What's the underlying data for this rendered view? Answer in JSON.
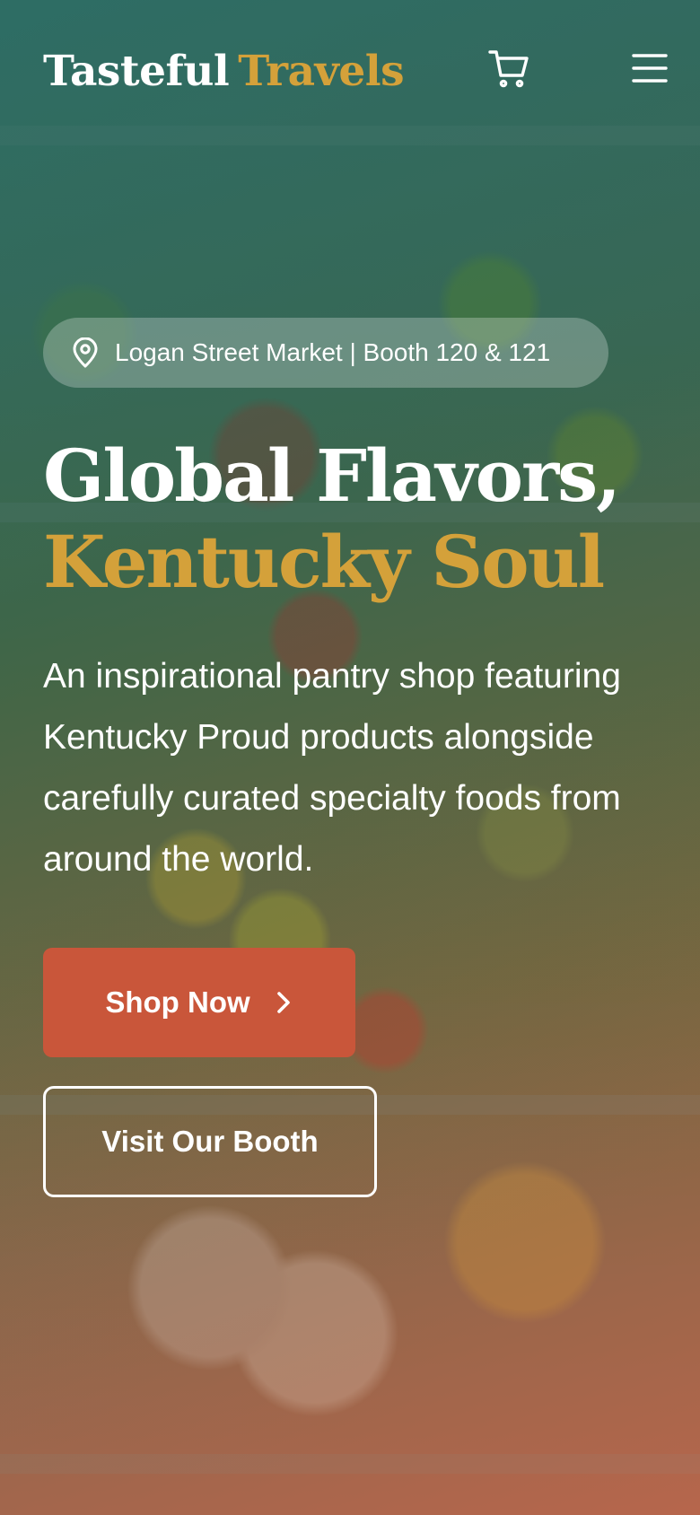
{
  "header": {
    "brand_primary": "Tasteful",
    "brand_accent": "Travels",
    "cart_icon": "cart-icon",
    "menu_icon": "hamburger-menu-icon"
  },
  "hero": {
    "location_icon": "map-pin-icon",
    "location_text": "Logan Street Market | Booth 120 & 121",
    "headline_line1": "Global Flavors,",
    "headline_line2": "Kentucky Soul",
    "description": "An inspirational pantry shop featuring Kentucky Proud products alongside carefully curated specialty foods from around the world.",
    "primary_button": "Shop Now",
    "primary_button_icon": "chevron-right-icon",
    "secondary_button": "Visit Our Booth"
  },
  "colors": {
    "accent_gold": "#d4a13a",
    "button_orange": "#c9563a",
    "text_white": "#ffffff"
  }
}
